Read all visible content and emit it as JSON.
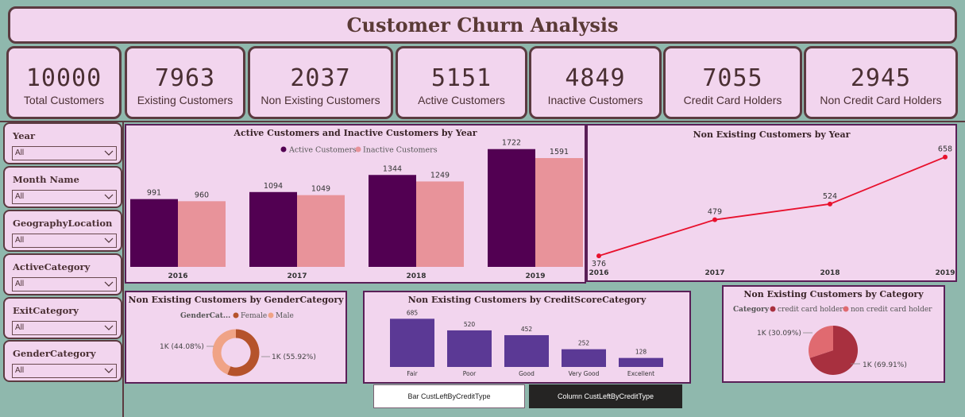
{
  "title": "Customer Churn Analysis",
  "kpis": [
    {
      "value": "10000",
      "label": "Total Customers"
    },
    {
      "value": "7963",
      "label": "Existing Customers"
    },
    {
      "value": "2037",
      "label": "Non Existing Customers"
    },
    {
      "value": "5151",
      "label": "Active Customers"
    },
    {
      "value": "4849",
      "label": "Inactive Customers"
    },
    {
      "value": "7055",
      "label": "Credit Card Holders"
    },
    {
      "value": "2945",
      "label": "Non Credit Card Holders"
    }
  ],
  "slicers": [
    {
      "title": "Year",
      "value": "All"
    },
    {
      "title": "Month Name",
      "value": "All"
    },
    {
      "title": "GeographyLocation",
      "value": "All"
    },
    {
      "title": "ActiveCategory",
      "value": "All"
    },
    {
      "title": "ExitCategory",
      "value": "All"
    },
    {
      "title": "GenderCategory",
      "value": "All"
    }
  ],
  "buttons": {
    "bar": "Bar CustLeftByCreditType",
    "column": "Column CustLeftByCreditType"
  },
  "colors": {
    "active": "#520052",
    "inactive": "#e8939a",
    "line": "#e8112d",
    "credit_bar": "#5b3995",
    "female": "#b5532b",
    "male": "#f0a386",
    "card_holder": "#a8303f",
    "non_card_holder": "#e06a70"
  },
  "chart_data": [
    {
      "type": "bar",
      "title": "Active Customers and Inactive Customers by Year",
      "categories": [
        "2016",
        "2017",
        "2018",
        "2019"
      ],
      "series": [
        {
          "name": "Active Customers",
          "values": [
            991,
            1094,
            1344,
            1722
          ]
        },
        {
          "name": "Inactive Customers",
          "values": [
            960,
            1049,
            1249,
            1591
          ]
        }
      ],
      "legend": "top",
      "ylim": [
        0,
        1800
      ]
    },
    {
      "type": "line",
      "title": "Non Existing Customers by Year",
      "x": [
        "2016",
        "2017",
        "2018",
        "2019"
      ],
      "values": [
        376,
        479,
        524,
        658
      ],
      "ylim": [
        340,
        680
      ]
    },
    {
      "type": "pie",
      "title": "Non Existing Customers by GenderCategory",
      "legend_title": "GenderCat...",
      "labels": [
        "Female",
        "Male"
      ],
      "values": [
        55.92,
        44.08
      ],
      "data_labels": [
        "1K (55.92%)",
        "1K (44.08%)"
      ],
      "donut": true
    },
    {
      "type": "bar",
      "title": "Non Existing Customers by CreditScoreCategory",
      "categories": [
        "Fair",
        "Poor",
        "Good",
        "Very Good",
        "Excellent"
      ],
      "values": [
        685,
        520,
        452,
        252,
        128
      ],
      "ylim": [
        0,
        700
      ]
    },
    {
      "type": "pie",
      "title": "Non Existing Customers by Category",
      "legend_title": "Category",
      "labels": [
        "credit card holder",
        "non credit card holder"
      ],
      "values": [
        69.91,
        30.09
      ],
      "data_labels": [
        "1K (69.91%)",
        "1K (30.09%)"
      ]
    }
  ]
}
